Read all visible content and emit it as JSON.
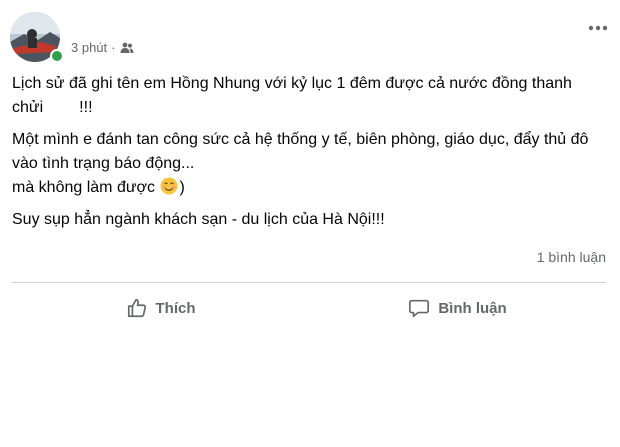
{
  "post": {
    "time": "3 phút",
    "separator": "·",
    "audience_icon": "friends-icon",
    "more_icon": "more-options-icon",
    "lines": [
      "Lịch sử đã ghi tên em Hồng Nhung với kỷ lục 1 đêm được cả nước đồng thanh chửi",
      "!!!",
      "Một mình e đánh tan công sức cả hệ thống y tế, biên phòng, giáo dục, đẩy thủ đô vào tình trạng báo động...",
      "mà không làm được",
      ")",
      "Suy sụp hẳn ngành khách sạn - du lịch của Hà Nội!!!"
    ],
    "comment_count": "1 bình luận"
  },
  "actions": {
    "like_label": "Thích",
    "comment_label": "Bình luận"
  },
  "colors": {
    "online": "#31a24c",
    "secondary_text": "#65676b",
    "divider": "#ced0d4"
  }
}
